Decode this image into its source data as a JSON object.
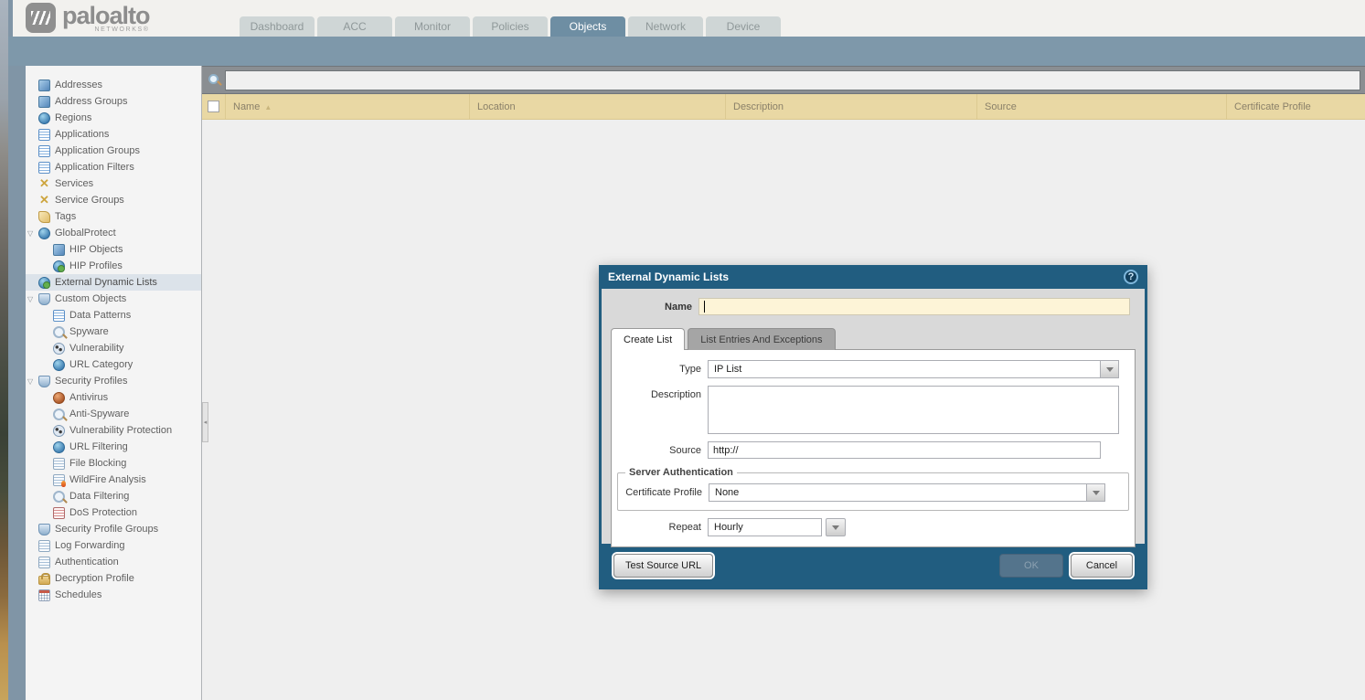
{
  "brand": {
    "logo_text": "paloalto",
    "logo_sub": "NETWORKS®"
  },
  "nav": {
    "tabs": [
      {
        "label": "Dashboard",
        "active": false
      },
      {
        "label": "ACC",
        "active": false
      },
      {
        "label": "Monitor",
        "active": false
      },
      {
        "label": "Policies",
        "active": false
      },
      {
        "label": "Objects",
        "active": true
      },
      {
        "label": "Network",
        "active": false
      },
      {
        "label": "Device",
        "active": false
      }
    ]
  },
  "sidebar": {
    "items": [
      {
        "label": "Addresses",
        "icon": "addresses-icon",
        "level": 0,
        "expandable": false,
        "selected": false
      },
      {
        "label": "Address Groups",
        "icon": "address-groups-icon",
        "level": 0,
        "expandable": false,
        "selected": false
      },
      {
        "label": "Regions",
        "icon": "regions-icon",
        "level": 0,
        "expandable": false,
        "selected": false
      },
      {
        "label": "Applications",
        "icon": "applications-icon",
        "level": 0,
        "expandable": false,
        "selected": false
      },
      {
        "label": "Application Groups",
        "icon": "application-groups-icon",
        "level": 0,
        "expandable": false,
        "selected": false
      },
      {
        "label": "Application Filters",
        "icon": "application-filters-icon",
        "level": 0,
        "expandable": false,
        "selected": false
      },
      {
        "label": "Services",
        "icon": "services-icon",
        "level": 0,
        "expandable": false,
        "selected": false
      },
      {
        "label": "Service Groups",
        "icon": "service-groups-icon",
        "level": 0,
        "expandable": false,
        "selected": false
      },
      {
        "label": "Tags",
        "icon": "tags-icon",
        "level": 0,
        "expandable": false,
        "selected": false
      },
      {
        "label": "GlobalProtect",
        "icon": "globalprotect-icon",
        "level": 0,
        "expandable": true,
        "selected": false
      },
      {
        "label": "HIP Objects",
        "icon": "hip-objects-icon",
        "level": 1,
        "expandable": false,
        "selected": false
      },
      {
        "label": "HIP Profiles",
        "icon": "hip-profiles-icon",
        "level": 1,
        "expandable": false,
        "selected": false
      },
      {
        "label": "External Dynamic Lists",
        "icon": "external-dynamic-lists-icon",
        "level": 0,
        "expandable": false,
        "selected": true
      },
      {
        "label": "Custom Objects",
        "icon": "custom-objects-icon",
        "level": 0,
        "expandable": true,
        "selected": false
      },
      {
        "label": "Data Patterns",
        "icon": "data-patterns-icon",
        "level": 1,
        "expandable": false,
        "selected": false
      },
      {
        "label": "Spyware",
        "icon": "spyware-icon",
        "level": 1,
        "expandable": false,
        "selected": false
      },
      {
        "label": "Vulnerability",
        "icon": "vulnerability-icon",
        "level": 1,
        "expandable": false,
        "selected": false
      },
      {
        "label": "URL Category",
        "icon": "url-category-icon",
        "level": 1,
        "expandable": false,
        "selected": false
      },
      {
        "label": "Security Profiles",
        "icon": "security-profiles-icon",
        "level": 0,
        "expandable": true,
        "selected": false
      },
      {
        "label": "Antivirus",
        "icon": "antivirus-icon",
        "level": 1,
        "expandable": false,
        "selected": false
      },
      {
        "label": "Anti-Spyware",
        "icon": "anti-spyware-icon",
        "level": 1,
        "expandable": false,
        "selected": false
      },
      {
        "label": "Vulnerability Protection",
        "icon": "vulnerability-protection-icon",
        "level": 1,
        "expandable": false,
        "selected": false
      },
      {
        "label": "URL Filtering",
        "icon": "url-filtering-icon",
        "level": 1,
        "expandable": false,
        "selected": false
      },
      {
        "label": "File Blocking",
        "icon": "file-blocking-icon",
        "level": 1,
        "expandable": false,
        "selected": false
      },
      {
        "label": "WildFire Analysis",
        "icon": "wildfire-analysis-icon",
        "level": 1,
        "expandable": false,
        "selected": false
      },
      {
        "label": "Data Filtering",
        "icon": "data-filtering-icon",
        "level": 1,
        "expandable": false,
        "selected": false
      },
      {
        "label": "DoS Protection",
        "icon": "dos-protection-icon",
        "level": 1,
        "expandable": false,
        "selected": false
      },
      {
        "label": "Security Profile Groups",
        "icon": "security-profile-groups-icon",
        "level": 0,
        "expandable": false,
        "selected": false
      },
      {
        "label": "Log Forwarding",
        "icon": "log-forwarding-icon",
        "level": 0,
        "expandable": false,
        "selected": false
      },
      {
        "label": "Authentication",
        "icon": "authentication-icon",
        "level": 0,
        "expandable": false,
        "selected": false
      },
      {
        "label": "Decryption Profile",
        "icon": "decryption-profile-icon",
        "level": 0,
        "expandable": false,
        "selected": false
      },
      {
        "label": "Schedules",
        "icon": "schedules-icon",
        "level": 0,
        "expandable": false,
        "selected": false
      }
    ]
  },
  "toolbar": {
    "search_value": ""
  },
  "table": {
    "columns": [
      "Name",
      "Location",
      "Description",
      "Source",
      "Certificate Profile"
    ],
    "sorted_column": "Name",
    "sort_glyph": "▲",
    "rows": []
  },
  "dialog": {
    "title": "External Dynamic Lists",
    "help_glyph": "?",
    "tabs": [
      {
        "label": "Create List",
        "active": true
      },
      {
        "label": "List Entries And Exceptions",
        "active": false
      }
    ],
    "fields": {
      "name_label": "Name",
      "name_value": "",
      "type_label": "Type",
      "type_value": "IP List",
      "description_label": "Description",
      "description_value": "",
      "source_label": "Source",
      "source_value": "http://",
      "server_auth_legend": "Server Authentication",
      "cert_profile_label": "Certificate Profile",
      "cert_profile_value": "None",
      "repeat_label": "Repeat",
      "repeat_value": "Hourly"
    },
    "buttons": {
      "test_source_url": "Test Source URL",
      "ok": "OK",
      "cancel": "Cancel"
    }
  },
  "colors": {
    "accent_teal": "#215d80",
    "band_slate": "#7e98aa",
    "table_header_tan": "#e9d8a4",
    "name_input_cream": "#fdf4d7"
  }
}
